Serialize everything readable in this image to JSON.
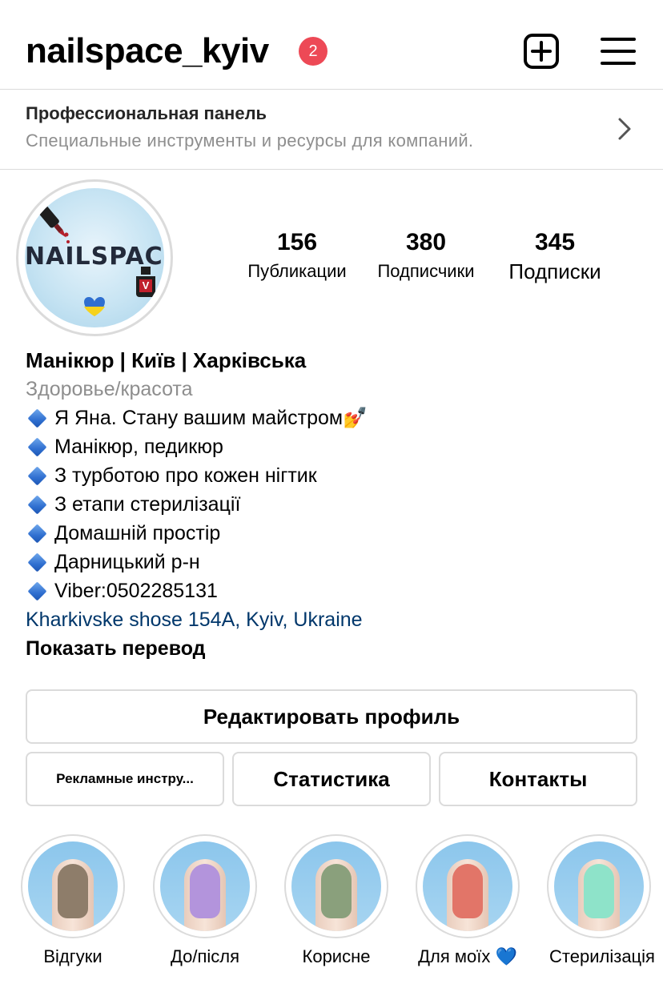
{
  "header": {
    "username": "nailspace_kyiv",
    "notification_count": "2"
  },
  "pro_panel": {
    "title": "Профессиональная панель",
    "subtitle": "Специальные инструменты и ресурсы для компаний."
  },
  "avatar": {
    "logo_text": "NAILSPACE",
    "badge_letter": "V"
  },
  "stats": {
    "posts": {
      "value": "156",
      "label": "Публикации"
    },
    "followers": {
      "value": "380",
      "label": "Подписчики"
    },
    "following": {
      "value": "345",
      "label": "Подписки"
    }
  },
  "bio": {
    "name": "Манікюр | Київ | Харківська",
    "category": "Здоровье/красота",
    "lines": [
      "Я Яна. Стану вашим майстром💅",
      "Манікюр, педикюр",
      "З турботою про кожен нігтик",
      "З етапи стерилізації",
      "Домашній простір",
      "Дарницький р-н",
      "Viber:0502285131"
    ],
    "address": "Kharkivske shose 154A, Kyiv, Ukraine",
    "translate": "Показать перевод"
  },
  "buttons": {
    "edit_profile": "Редактировать профиль",
    "ad_tools": "Рекламные инстру...",
    "statistics": "Статистика",
    "contacts": "Контакты"
  },
  "highlights": [
    {
      "label": "Відгуки",
      "nail_color": "#8e7d6a"
    },
    {
      "label": "До/після",
      "nail_color": "#b394dc"
    },
    {
      "label": "Корисне",
      "nail_color": "#8aa07c"
    },
    {
      "label": "Для моїх 💙",
      "nail_color": "#e27568"
    },
    {
      "label": "Стерилізація",
      "nail_color": "#8ee3c9"
    }
  ],
  "colors": {
    "badge": "#ed4956",
    "link": "#00376b",
    "border": "#dbdbdb",
    "secondary_text": "#8e8e8e"
  }
}
